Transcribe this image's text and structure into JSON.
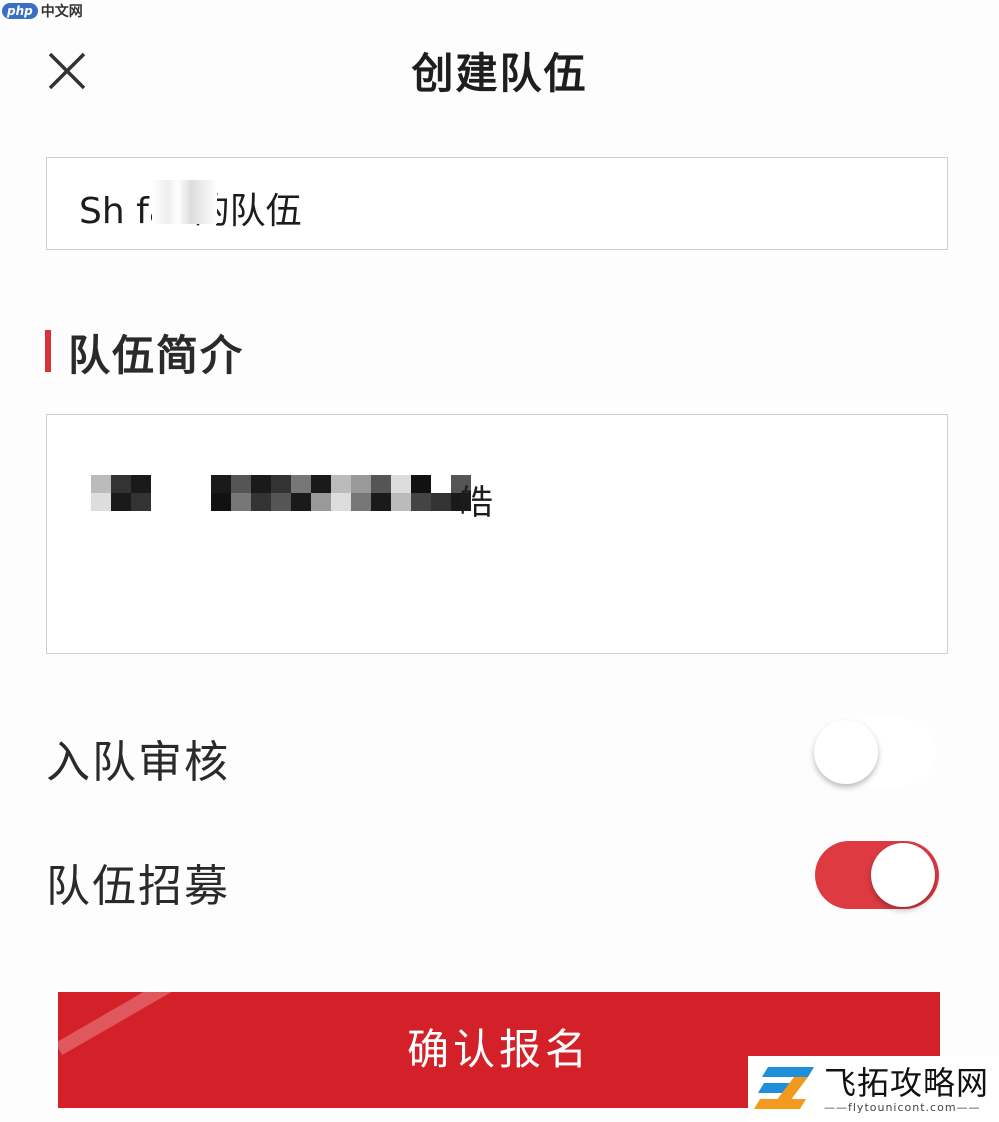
{
  "watermark_top": {
    "badge": "php",
    "text": "中文网"
  },
  "header": {
    "title": "创建队伍"
  },
  "team_name": {
    "value": "Sh  fan的队伍"
  },
  "intro_section": {
    "title": "队伍简介",
    "value_visible_end": "皓"
  },
  "settings": [
    {
      "label": "入队审核",
      "enabled": false
    },
    {
      "label": "队伍招募",
      "enabled": true
    }
  ],
  "confirm_button": {
    "label": "确认报名"
  },
  "watermark_bottom": {
    "title": "飞拓攻略网",
    "subtitle": "——flytounicont.com——"
  },
  "colors": {
    "accent": "#d42028",
    "toggle_on": "#dd3a42",
    "section_bar": "#d8333b"
  }
}
